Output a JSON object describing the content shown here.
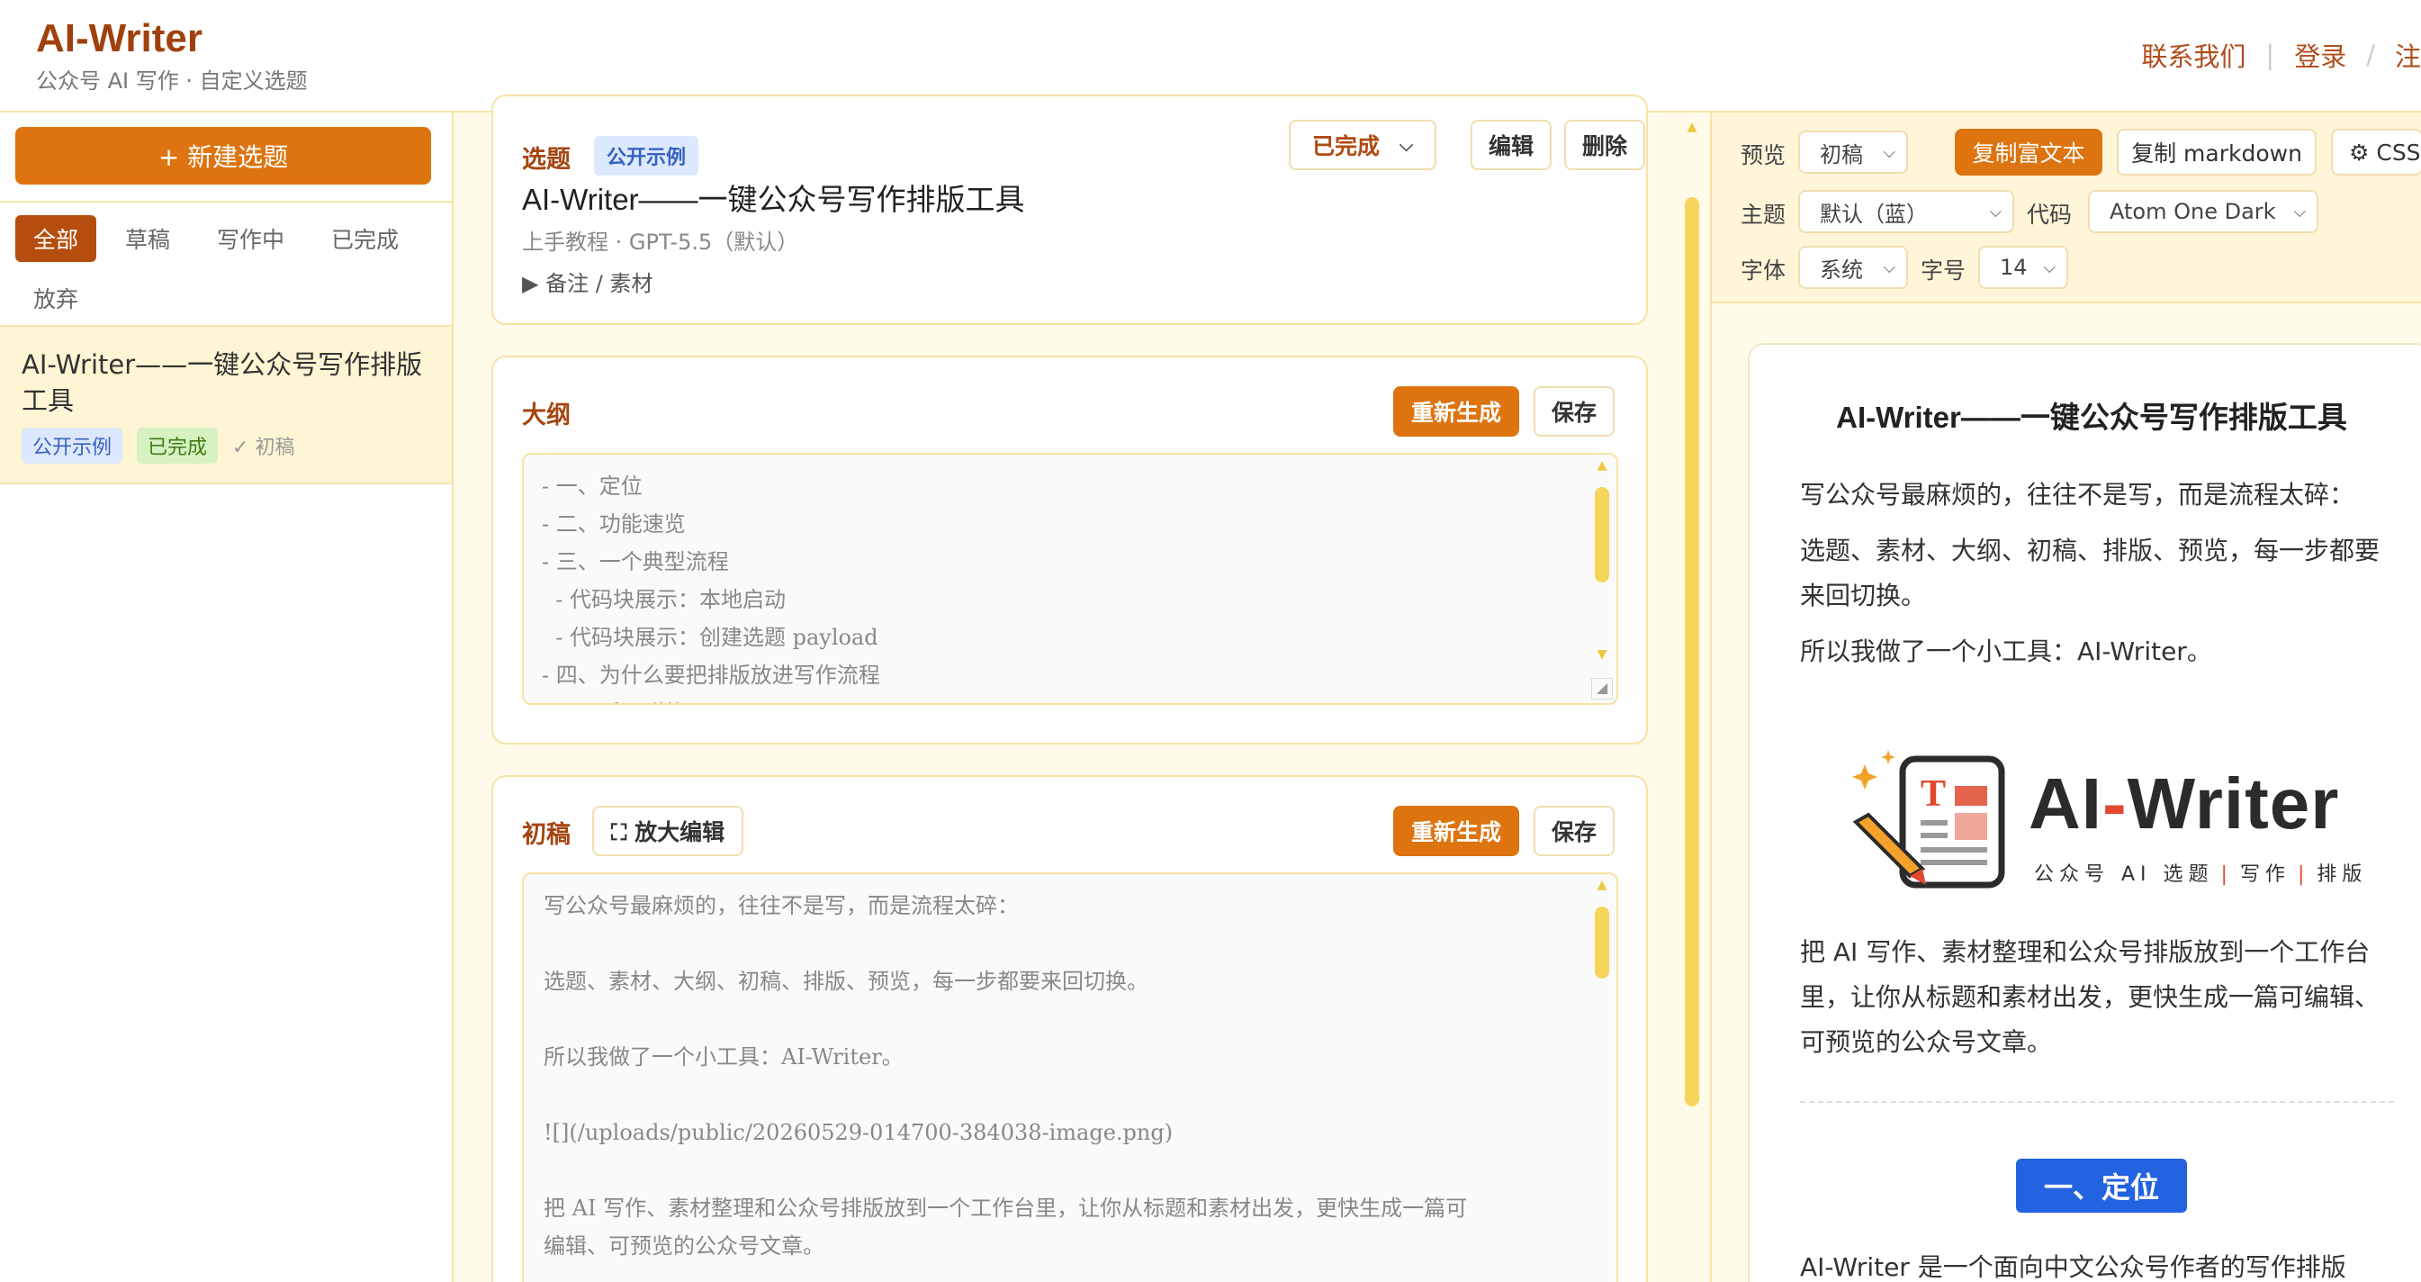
{
  "header": {
    "brand": "AI-Writer",
    "tagline": "公众号 AI 写作 · 自定义选题",
    "links": {
      "contact": "联系我们",
      "sep1": "|",
      "login": "登录",
      "sep2": "/",
      "register": "注"
    }
  },
  "sidebar": {
    "new_topic": "+ 新建选题",
    "filters": [
      "全部",
      "草稿",
      "写作中",
      "已完成",
      "放弃"
    ],
    "items": [
      {
        "title": "AI-Writer——一键公众号写作排版工具",
        "tag_public": "公开示例",
        "tag_status": "已完成",
        "stage": "✓ 初稿"
      }
    ]
  },
  "topic_card": {
    "label": "选题",
    "badge": "公开示例",
    "status": "已完成",
    "edit": "编辑",
    "delete": "删除",
    "title": "AI-Writer——一键公众号写作排版工具",
    "meta": "上手教程 · GPT-5.5（默认）",
    "notes": "▶ 备注 / 素材"
  },
  "outline_card": {
    "label": "大纲",
    "regenerate": "重新生成",
    "save": "保存",
    "lines": [
      "- 一、定位",
      "- 二、功能速览",
      "- 三、一个典型流程",
      "  - 代码块展示：本地启动",
      "  - 代码块展示：创建选题 payload",
      "- 四、为什么要把排版放进写作流程",
      "- 五、适用群体"
    ]
  },
  "draft_card": {
    "label": "初稿",
    "zoom_edit": "⛶ 放大编辑",
    "regenerate": "重新生成",
    "save": "保存",
    "lines": [
      "写公众号最麻烦的，往往不是写，而是流程太碎：",
      "",
      "选题、素材、大纲、初稿、排版、预览，每一步都要来回切换。",
      "",
      "所以我做了一个小工具：AI-Writer。",
      "",
      "![](/uploads/public/20260529-014700-384038-image.png)",
      "",
      "把 AI 写作、素材整理和公众号排版放到一个工作台里，让你从标题和素材出发，更快生成一篇可",
      "编辑、可预览的公众号文章。"
    ]
  },
  "toolbar": {
    "preview_label": "预览",
    "preview_value": "初稿",
    "copy_rich": "复制富文本",
    "copy_md": "复制 markdown",
    "css_btn": "⚙ CSS",
    "theme_label": "主题",
    "theme_value": "默认（蓝）",
    "code_label": "代码",
    "code_value": "Atom One Dark",
    "font_label": "字体",
    "font_value": "系统",
    "size_label": "字号",
    "size_value": "14"
  },
  "preview": {
    "title": "AI-Writer——一键公众号写作排版工具",
    "p1": "写公众号最麻烦的，往往不是写，而是流程太碎：",
    "p2": "选题、素材、大纲、初稿、排版、预览，每一步都要来回切换。",
    "p3": "所以我做了一个小工具：AI-Writer。",
    "logo": {
      "word_a": "AI",
      "word_dash": "-",
      "word_b": "Writer",
      "sub_a": "公众号 AI 选题",
      "sub_b": "写作",
      "sub_c": "排版",
      "bar": "|"
    },
    "p4": "把 AI 写作、素材整理和公众号排版放到一个工作台里，让你从标题和素材出发，更快生成一篇可编辑、可预览的公众号文章。",
    "section_1": "一、定位",
    "p5": "AI-Writer 是一个面向中文公众号作者的写作排版"
  },
  "colors": {
    "brand": "#a0410d",
    "accent": "#dd7410",
    "border": "#f6e4a6",
    "panel_bg": "#fffbea",
    "blue": "#2362e0"
  }
}
